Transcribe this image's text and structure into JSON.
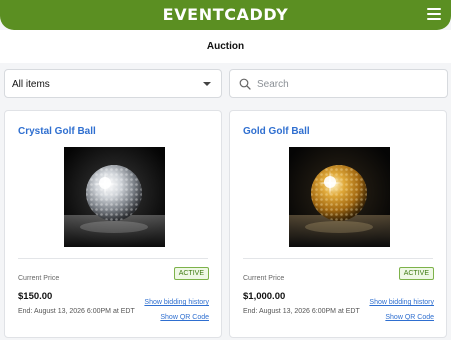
{
  "app": {
    "brand": "EVENTCADDY",
    "menu_icon": "hamburger-icon",
    "brand_color": "#5b8f22",
    "link_color": "#2f6fd0"
  },
  "page": {
    "title": "Auction"
  },
  "filters": {
    "category_selected": "All items",
    "search_placeholder": "Search",
    "search_value": ""
  },
  "items": [
    {
      "title": "Crystal Golf Ball",
      "image": "crystal-golf-ball",
      "status": "ACTIVE",
      "price_label": "Current Price",
      "price": "$150.00",
      "end": "End: August 13, 2026 6:00PM at EDT",
      "bid_link": "Show bidding history",
      "qr_link": "Show QR Code"
    },
    {
      "title": "Gold Golf Ball",
      "image": "gold-golf-ball",
      "status": "ACTIVE",
      "price_label": "Current Price",
      "price": "$1,000.00",
      "end": "End: August 13, 2026 6:00PM at EDT",
      "bid_link": "Show bidding history",
      "qr_link": "Show QR Code"
    }
  ]
}
